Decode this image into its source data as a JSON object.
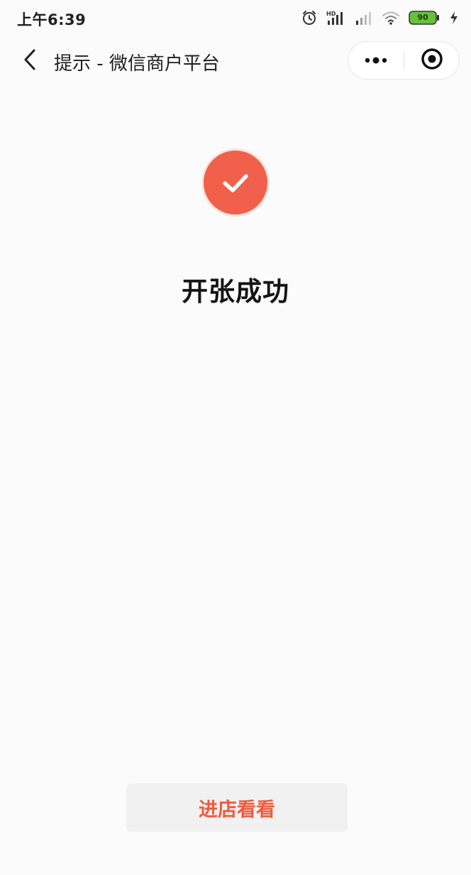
{
  "status_bar": {
    "time": "上午6:39",
    "battery_level": "90",
    "icons": [
      "alarm-icon",
      "hd-signal-icon",
      "signal-icon",
      "wifi-icon",
      "battery-icon",
      "charging-icon"
    ]
  },
  "nav": {
    "title": "提示 - 微信商户平台",
    "back_icon": "chevron-left-icon",
    "more_icon": "more-dots-icon",
    "close_icon": "target-close-icon"
  },
  "result": {
    "icon": "check-circle-icon",
    "title": "开张成功"
  },
  "actions": {
    "visit_store_label": "进店看看"
  },
  "colors": {
    "accent": "#f0604b",
    "button_text": "#ee5a3c",
    "background": "#fcfbfc",
    "button_bg": "#f2f1f2",
    "battery_green": "#67c23a"
  }
}
